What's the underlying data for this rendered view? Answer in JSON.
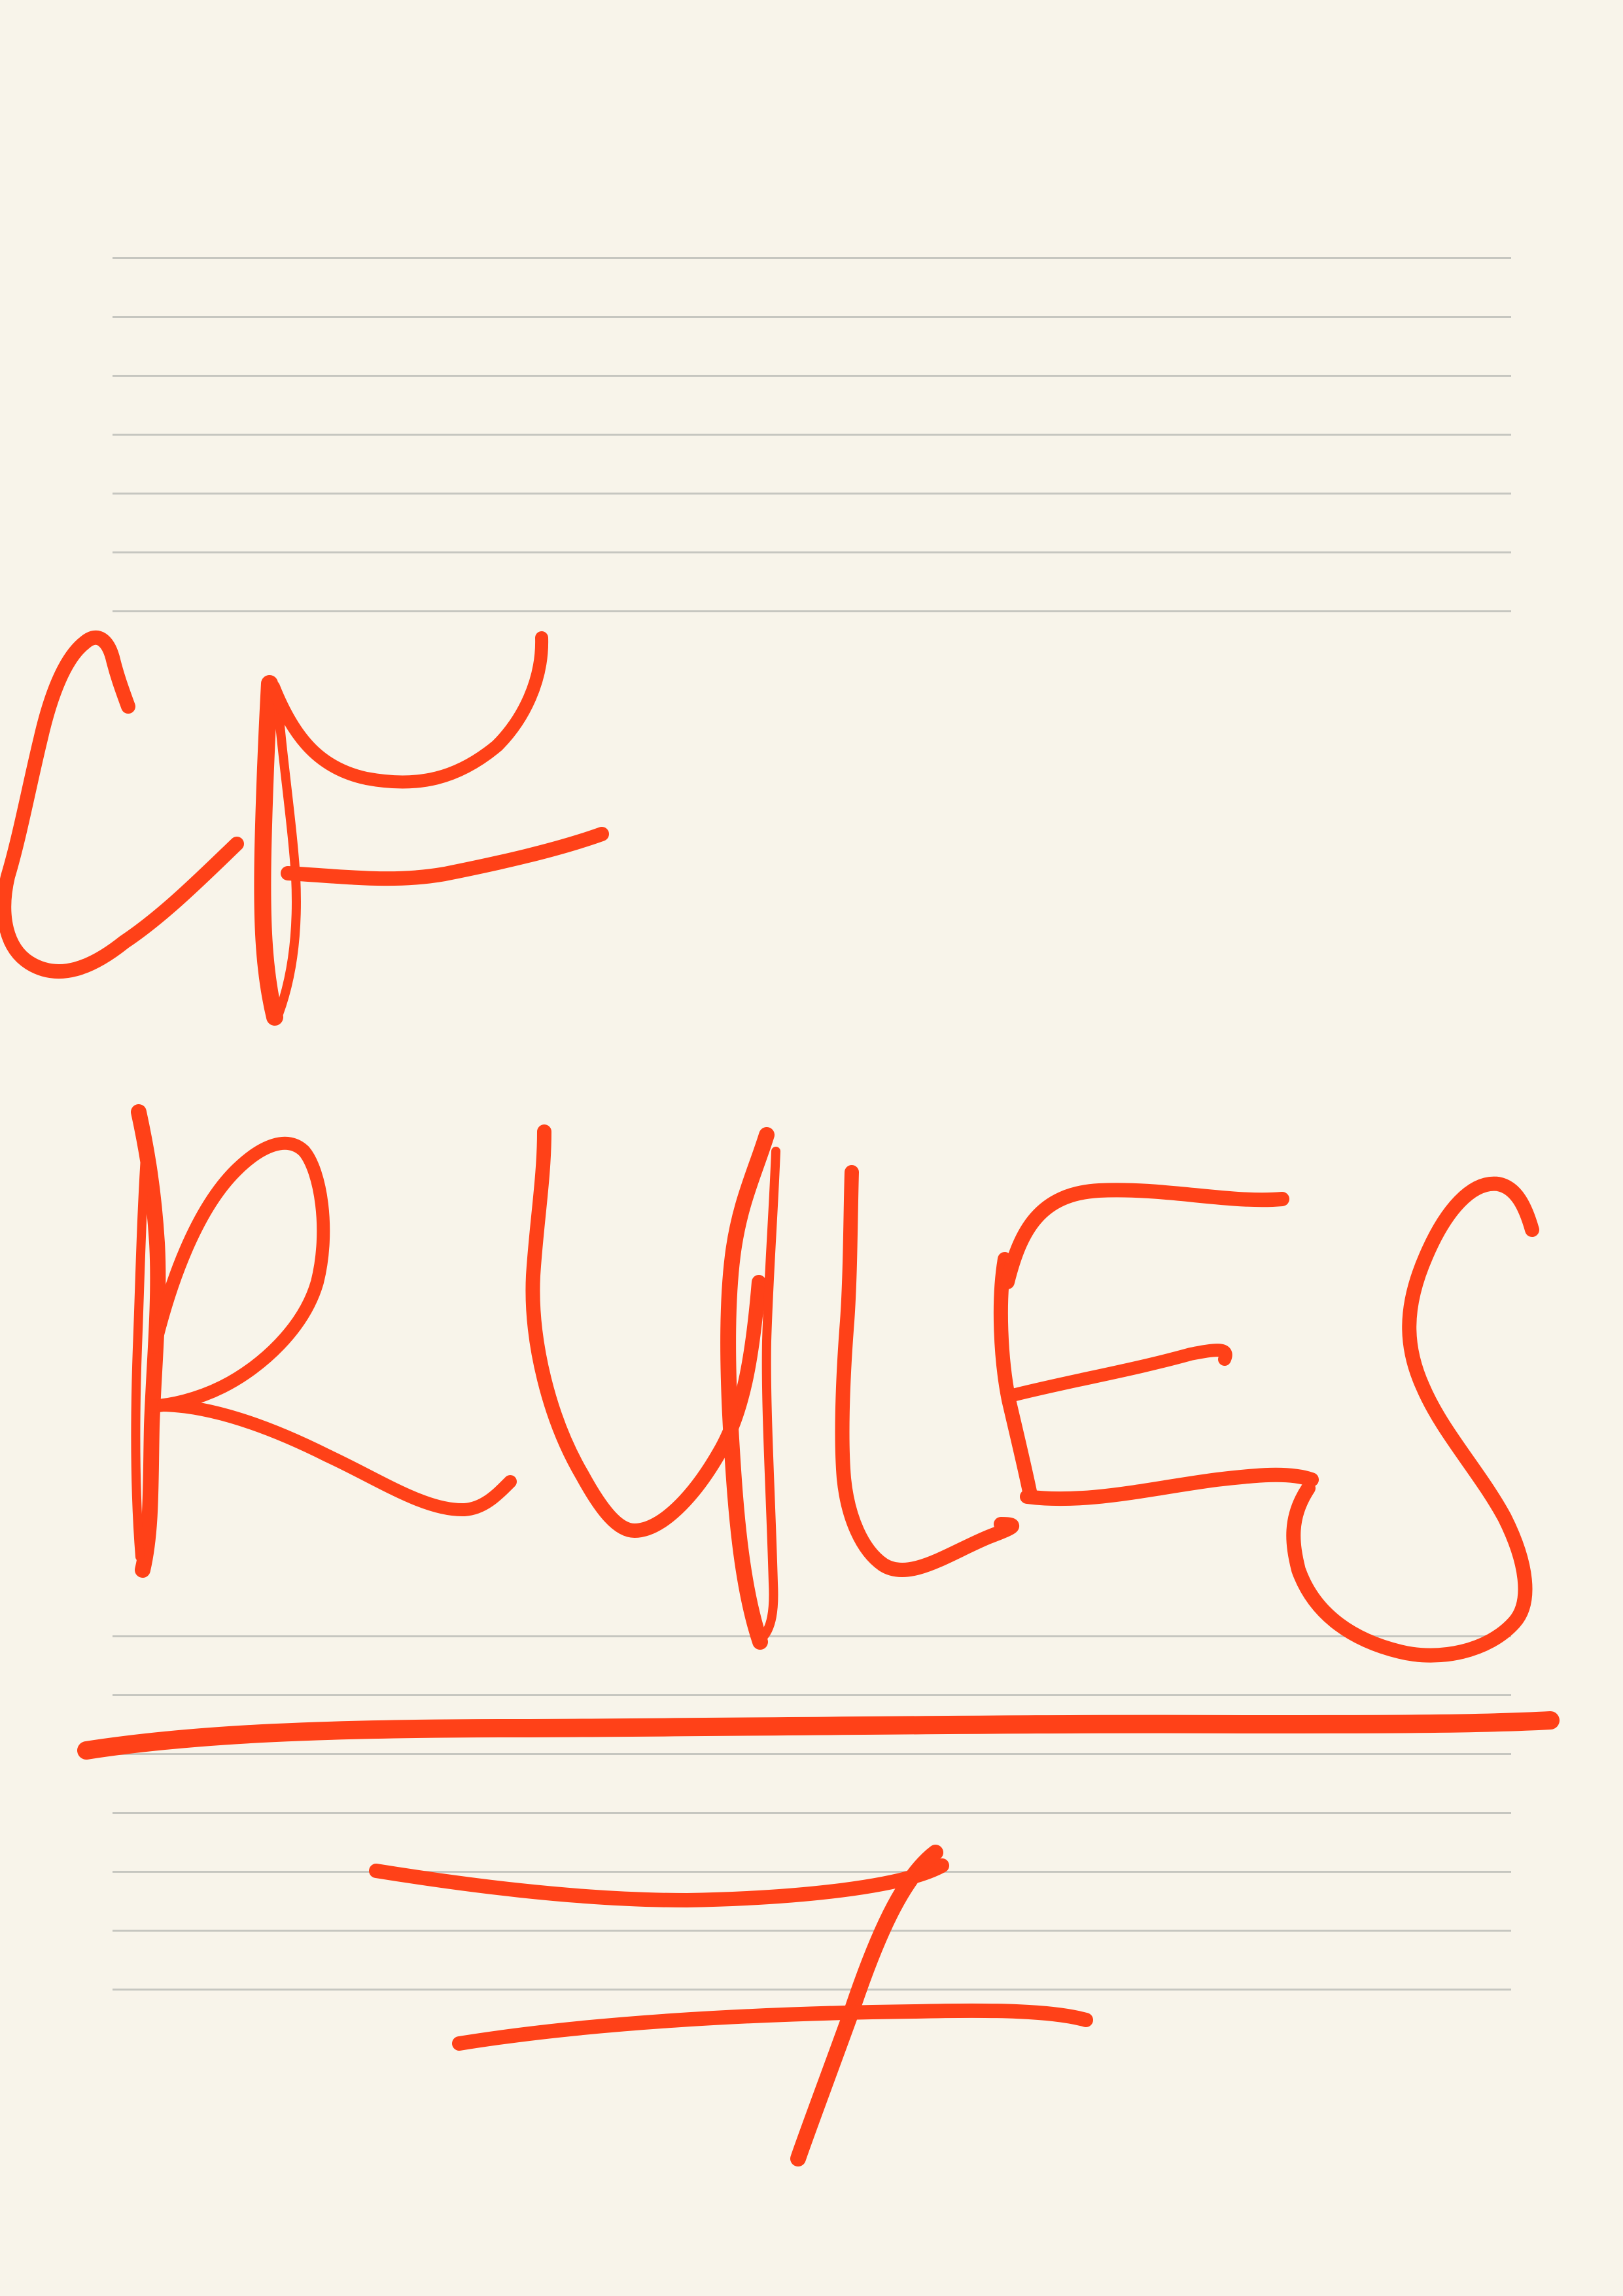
{
  "colors": {
    "background": "#f8f4ea",
    "ink": "#ff4118",
    "rule_line": "#c6c6c0"
  },
  "lettering": {
    "line_1": "CF",
    "line_2": "RULES",
    "line_3": "7"
  }
}
